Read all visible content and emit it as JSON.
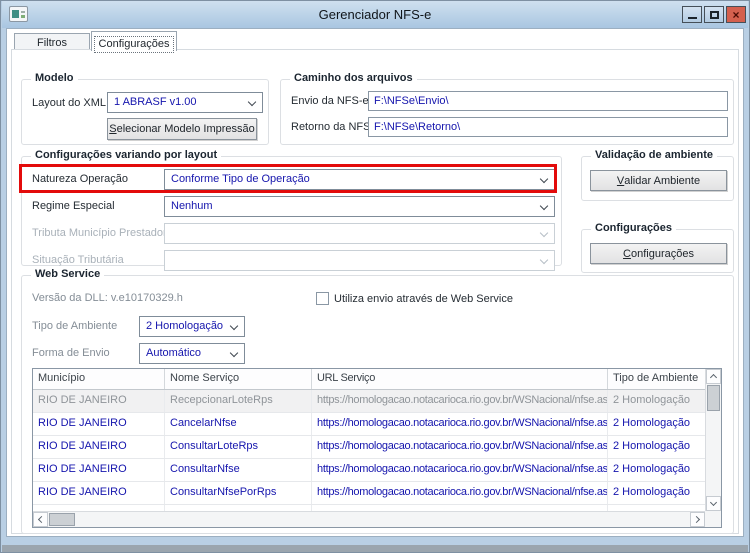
{
  "window": {
    "title": "Gerenciador NFS-e"
  },
  "icons": {
    "close_glyph": "×"
  },
  "tabs": [
    {
      "label": "Filtros"
    },
    {
      "label": "Configurações"
    }
  ],
  "modelo": {
    "legend": "Modelo",
    "layout_label": "Layout do XML",
    "layout_value": "1 ABRASF v1.00",
    "print_button": {
      "u": "S",
      "rest": "elecionar Modelo Impressão"
    }
  },
  "caminho": {
    "legend": "Caminho dos arquivos",
    "envio_label": "Envio da NFS-e",
    "envio_value": "F:\\NFSe\\Envio\\",
    "retorno_label": "Retorno da NFS-e",
    "retorno_value": "F:\\NFSe\\Retorno\\"
  },
  "layout_cfg": {
    "legend": "Configurações variando por layout",
    "natureza_label": "Natureza Operação",
    "natureza_value": "Conforme Tipo de Operação",
    "regime_label": "Regime Especial",
    "regime_value": "Nenhum",
    "tributa_label": "Tributa Município Prestador",
    "tributa_value": "",
    "situacao_label": "Situação Tributária",
    "situacao_value": ""
  },
  "validacao": {
    "legend": "Validação de ambiente",
    "button": {
      "u": "V",
      "rest": "alidar Ambiente"
    }
  },
  "config_group": {
    "legend": "Configurações",
    "button": {
      "u": "C",
      "rest": "onfigurações"
    }
  },
  "webservice": {
    "legend": "Web Service",
    "dll_version": "Versão da DLL: v.e10170329.h",
    "checkbox_label": "Utiliza envio através de Web Service",
    "tipo_label": "Tipo de Ambiente",
    "tipo_value": "2 Homologação",
    "forma_label": "Forma de Envio",
    "forma_value": "Automático"
  },
  "table": {
    "headers": [
      "Município",
      "Nome Serviço",
      "URL Serviço",
      "Tipo de Ambiente"
    ],
    "rows": [
      {
        "municipio": "RIO DE JANEIRO",
        "servico": "RecepcionarLoteRps",
        "url": "https://homologacao.notacarioca.rio.gov.br/WSNacional/nfse.asm",
        "ambiente": "2 Homologação"
      },
      {
        "municipio": "RIO DE JANEIRO",
        "servico": "CancelarNfse",
        "url": "https://homologacao.notacarioca.rio.gov.br/WSNacional/nfse.asm",
        "ambiente": "2 Homologação"
      },
      {
        "municipio": "RIO DE JANEIRO",
        "servico": "ConsultarLoteRps",
        "url": "https://homologacao.notacarioca.rio.gov.br/WSNacional/nfse.asm",
        "ambiente": "2 Homologação"
      },
      {
        "municipio": "RIO DE JANEIRO",
        "servico": "ConsultarNfse",
        "url": "https://homologacao.notacarioca.rio.gov.br/WSNacional/nfse.asm",
        "ambiente": "2 Homologação"
      },
      {
        "municipio": "RIO DE JANEIRO",
        "servico": "ConsultarNfsePorRps",
        "url": "https://homologacao.notacarioca.rio.gov.br/WSNacional/nfse.asm",
        "ambiente": "2 Homologação"
      }
    ]
  },
  "colors": {
    "titlebar": "#aac6e1",
    "value_text_blue": "#1515ad",
    "annotation_red": "#e30b0b",
    "close_button_red": "#d4604e"
  }
}
